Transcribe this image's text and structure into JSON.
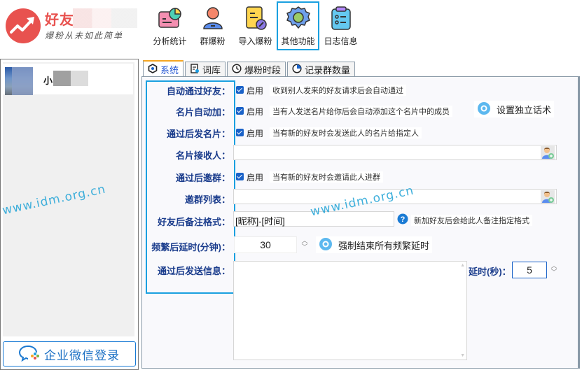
{
  "app": {
    "logo_title": "好友",
    "logo_slogan": "爆粉从未如此简单"
  },
  "toolbar": {
    "items": [
      {
        "label": "分析统计",
        "icon": "analytics-icon",
        "active": false
      },
      {
        "label": "群爆粉",
        "icon": "group-user-icon",
        "active": false
      },
      {
        "label": "导入爆粉",
        "icon": "import-file-icon",
        "active": false
      },
      {
        "label": "其他功能",
        "icon": "gear-icon",
        "active": true
      },
      {
        "label": "日志信息",
        "icon": "clipboard-log-icon",
        "active": false
      }
    ]
  },
  "sidebar": {
    "contacts": [
      {
        "name": "小"
      }
    ],
    "wecom_login_label": "企业微信登录"
  },
  "tabs": [
    {
      "label": "系统",
      "icon": "hexagon-dot-icon",
      "active": true
    },
    {
      "label": "词库",
      "icon": "document-icon",
      "active": false
    },
    {
      "label": "爆粉时段",
      "icon": "clock-icon",
      "active": false
    },
    {
      "label": "记录群数量",
      "icon": "pie-icon",
      "active": false
    }
  ],
  "settings": {
    "auto_accept": {
      "label": "自动通过好友：",
      "checkbox_label": "启用",
      "checked": true,
      "hint": "收到别人发来的好友请求后会自动通过"
    },
    "card_auto_add": {
      "label": "名片自动加：",
      "checkbox_label": "启用",
      "checked": true,
      "hint": "当有人发送名片给你后会自动添加这个名片中的成员",
      "button_label": "设置独立话术"
    },
    "send_card_after": {
      "label": "通过后发名片：",
      "checkbox_label": "启用",
      "checked": true,
      "hint": "当有新的好友时会发送此人的名片给指定人"
    },
    "card_receiver": {
      "label": "名片接收人：",
      "value": ""
    },
    "invite_group_after": {
      "label": "通过后邀群：",
      "checkbox_label": "启用",
      "checked": true,
      "hint": "当有新的好友时会邀请此人进群"
    },
    "invite_group_list": {
      "label": "邀群列表：",
      "value": ""
    },
    "remark_format": {
      "label": "好友后备注格式：",
      "value": "[昵称]-[时间]",
      "hint": "新加好友后会给此人备注指定格式"
    },
    "freq_delay": {
      "label": "频繁后延时(分钟)：",
      "value": "30",
      "button_label": "强制结束所有频繁延时"
    },
    "send_message": {
      "label": "通过后发送信息：",
      "value": "",
      "delay_label": "延时(秒)：",
      "delay_value": "5"
    }
  },
  "watermark": "www.idm.org.cn"
}
